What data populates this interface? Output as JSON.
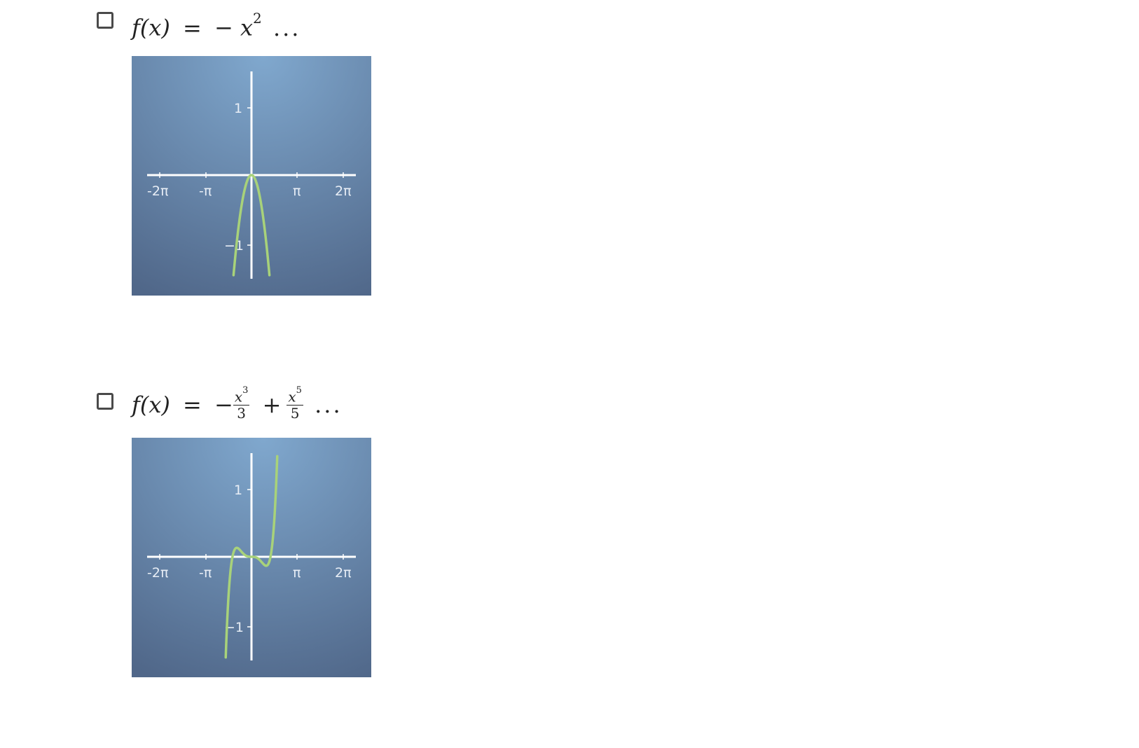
{
  "options": [
    {
      "formula": {
        "lhs": "f(x)",
        "equals": "=",
        "minus": "−",
        "var": "x",
        "power": "2",
        "dots": "..."
      },
      "plot": {
        "x_ticks": [
          "-2π",
          "-π",
          "π",
          "2π"
        ],
        "y_ticks": [
          "1",
          "−1"
        ],
        "curve_color": "#a8d27a",
        "curve_fn": "-x^2"
      }
    },
    {
      "formula": {
        "lhs": "f(x)",
        "equals": "=",
        "minus": "−",
        "term1_num_var": "x",
        "term1_num_pow": "3",
        "term1_den": "3",
        "plus": "+",
        "term2_num_var": "x",
        "term2_num_pow": "5",
        "term2_den": "5",
        "dots": "..."
      },
      "plot": {
        "x_ticks": [
          "-2π",
          "-π",
          "π",
          "2π"
        ],
        "y_ticks": [
          "1",
          "−1"
        ],
        "curve_color": "#a8d27a",
        "curve_fn": "-x^3/3 + x^5/5"
      }
    }
  ],
  "colors": {
    "plot_bg_top": "#7fa6cc",
    "plot_bg_bottom": "#52698c",
    "axis": "#ffffff"
  }
}
